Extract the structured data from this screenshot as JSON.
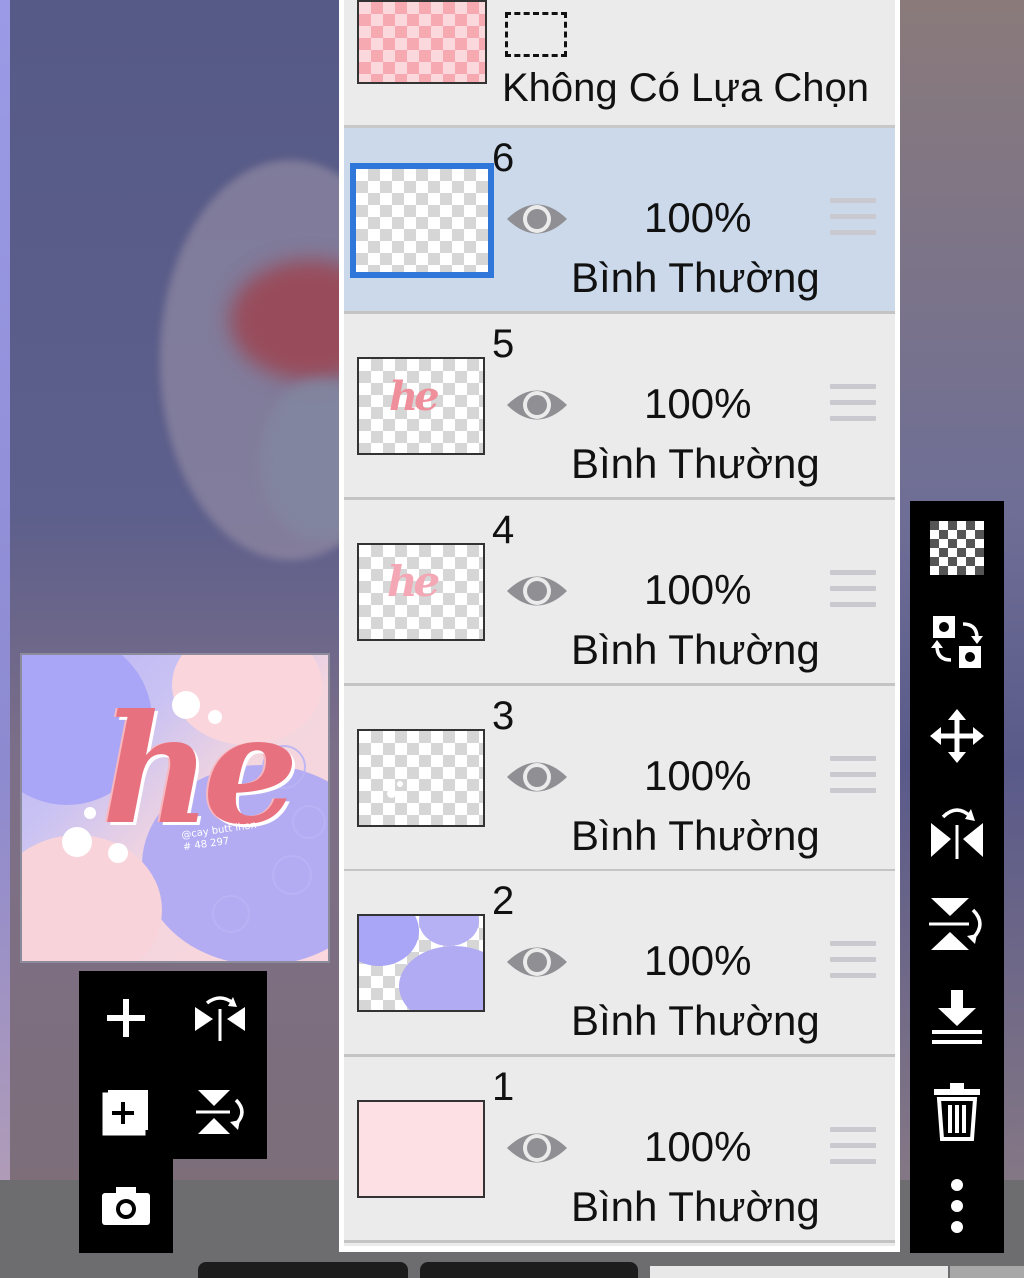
{
  "selection": {
    "label": "Không Có Lựa Chọn"
  },
  "layers": [
    {
      "number": "6",
      "opacity": "100%",
      "blend_mode": "Bình Thường",
      "selected": true
    },
    {
      "number": "5",
      "opacity": "100%",
      "blend_mode": "Bình Thường",
      "selected": false
    },
    {
      "number": "4",
      "opacity": "100%",
      "blend_mode": "Bình Thường",
      "selected": false
    },
    {
      "number": "3",
      "opacity": "100%",
      "blend_mode": "Bình Thường",
      "selected": false
    },
    {
      "number": "2",
      "opacity": "100%",
      "blend_mode": "Bình Thường",
      "selected": false
    },
    {
      "number": "1",
      "opacity": "100%",
      "blend_mode": "Bình Thường",
      "selected": false
    }
  ],
  "preview": {
    "title_text": "he",
    "credit_line1": "@cay butt ihon",
    "credit_line2": "#  48 297"
  },
  "left_toolbar": [
    "plus-icon",
    "flip-horizontal-icon",
    "add-layer-icon",
    "flip-vertical-icon",
    "camera-icon"
  ],
  "right_toolbar": [
    "transparency-icon",
    "swap-icon",
    "move-icon",
    "flip-horizontal-icon",
    "flip-vertical-icon",
    "merge-down-icon",
    "trash-icon",
    "more-icon"
  ],
  "colors": {
    "selected_layer_bg": "#cbd9ea",
    "selected_layer_border": "#2f77d9",
    "panel_bg": "#ebebeb",
    "toolbar_bg": "#000000",
    "layer1_fill": "#fde0e4"
  }
}
